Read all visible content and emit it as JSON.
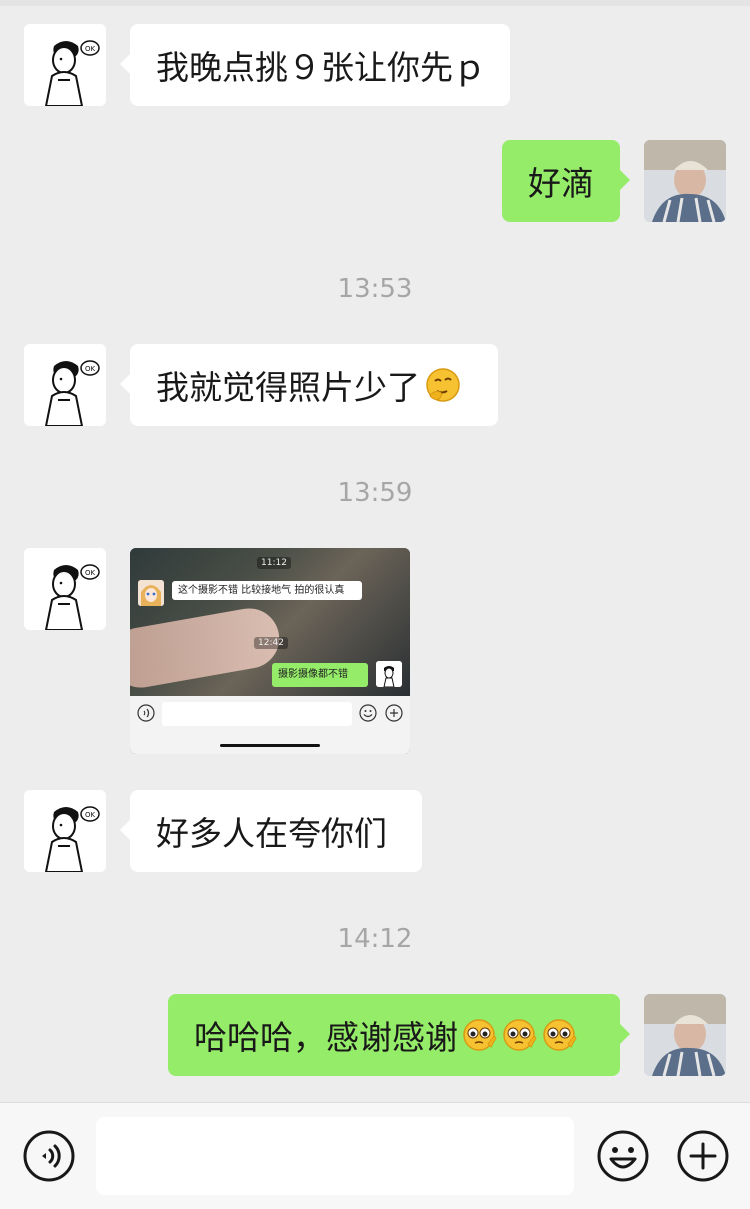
{
  "messages": [
    {
      "side": "in",
      "text": "我晚点挑９张让你先ｐ"
    },
    {
      "side": "out",
      "text": "好滴"
    },
    {
      "time": "13:53"
    },
    {
      "side": "in",
      "text": "我就觉得照片少了"
    },
    {
      "time": "13:59"
    },
    {
      "side": "in",
      "type": "image",
      "embedded": {
        "time1": "11:12",
        "incoming": "这个摄影不错 比较接地气 拍的很认真",
        "time2": "12:42",
        "outgoing": "摄影摄像都不错"
      }
    },
    {
      "side": "in",
      "text": "好多人在夸你们"
    },
    {
      "time": "14:12"
    },
    {
      "side": "out",
      "text": "哈哈哈，感谢感谢"
    }
  ],
  "icons": {
    "voice": "voice-icon",
    "emoji": "emoji-icon",
    "plus": "plus-icon",
    "thinking_emoji": "thinking-face-emoji",
    "pleading_emoji": "pleading-face-emoji"
  },
  "colors": {
    "background": "#ededed",
    "incoming_bubble": "#ffffff",
    "outgoing_bubble": "#95ec69",
    "timestamp": "#a6a6a6"
  }
}
